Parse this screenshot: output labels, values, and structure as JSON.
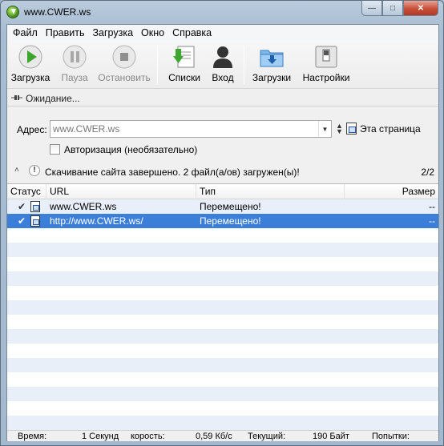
{
  "window": {
    "title": "www.CWER.ws"
  },
  "menu": [
    "Файл",
    "Править",
    "Загрузка",
    "Окно",
    "Справка"
  ],
  "toolbar": {
    "download": "Загрузка",
    "pause": "Пауза",
    "stop": "Остановить",
    "lists": "Списки",
    "login": "Вход",
    "downloads": "Загрузки",
    "settings": "Настройки"
  },
  "status": {
    "text": "Ожидание..."
  },
  "address": {
    "label": "Адрес:",
    "value": "www.CWER.ws",
    "this_page": "Эта страница"
  },
  "auth": {
    "label": "Авторизация (необязательно)",
    "checked": false
  },
  "result": {
    "message": "Скачивание сайта завершено. 2 файл(а/ов) загружен(ы)!",
    "count": "2/2"
  },
  "table": {
    "columns": [
      "Статус",
      "URL",
      "Тип",
      "Размер"
    ],
    "rows": [
      {
        "url": "www.CWER.ws",
        "type": "Перемещено!",
        "size": "--"
      },
      {
        "url": "http://www.CWER.ws/",
        "type": "Перемещено!",
        "size": "--"
      }
    ]
  },
  "footer": {
    "time_label": "Время:",
    "time_value": "1 Секунд",
    "speed_label": "корость:",
    "speed_value": "0,59 Кб/с",
    "current_label": "Текущий:",
    "current_value": "190 Байт",
    "attempts_label": "Попытки:"
  },
  "colors": {
    "selection": "#3c7fd8",
    "row_alt": "#e9eff9"
  }
}
